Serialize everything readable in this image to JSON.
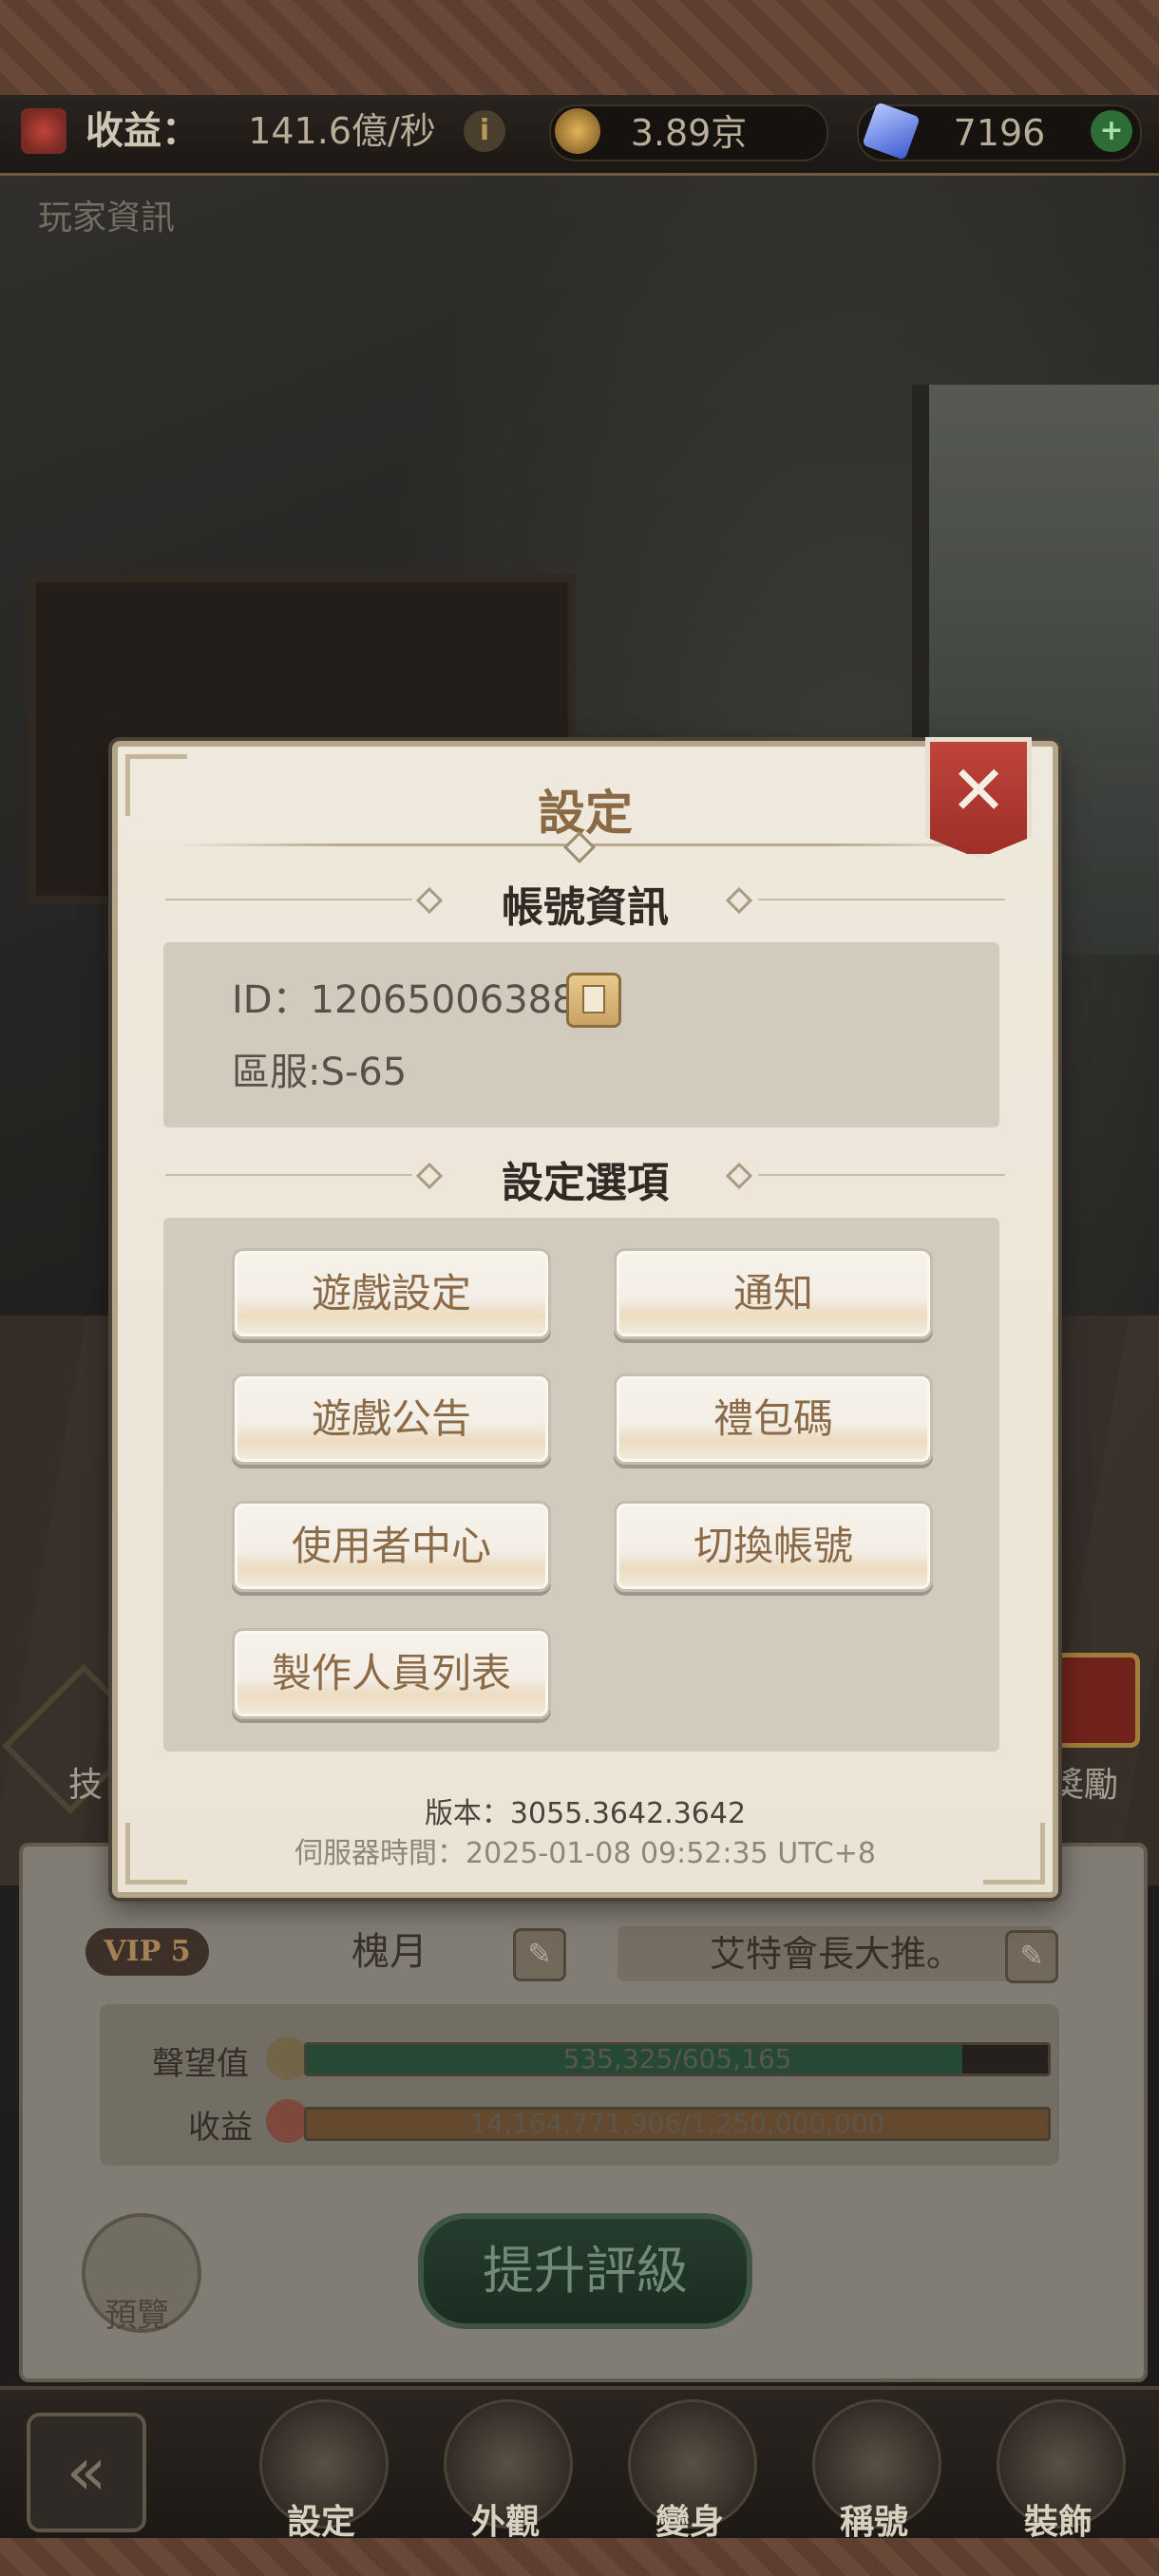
{
  "resources": {
    "income_label": "收益：",
    "income_value": "141.6億/秒",
    "coin_value": "3.89京",
    "gem_value": "7196"
  },
  "scene": {
    "player_info_label": "玩家資訊",
    "left_side_label": "技",
    "right_side_label": "獎勵"
  },
  "profile": {
    "vip": "VIP 5",
    "name": "槐月",
    "motto": "艾特會長大推。",
    "reputation_label": "聲望值",
    "reputation_text": "535,325/605,165",
    "reputation_progress": 0.884,
    "income_label": "收益",
    "income_text": "14,164,771,906/1,250,000,000",
    "income_progress": 1.0,
    "upgrade_label": "提升評級",
    "preview_label": "預覽"
  },
  "nav": {
    "items": [
      {
        "label": "設定",
        "icon": "gear-icon"
      },
      {
        "label": "外觀",
        "icon": "outfit-icon"
      },
      {
        "label": "變身",
        "icon": "mask-icon"
      },
      {
        "label": "稱號",
        "icon": "crown-icon"
      },
      {
        "label": "裝飾",
        "icon": "mushroom-icon"
      }
    ]
  },
  "modal": {
    "title": "設定",
    "account_header": "帳號資訊",
    "id_text": "ID：12065006388",
    "server_text": "區服:S-65",
    "options_header": "設定選項",
    "options": [
      "遊戲設定",
      "通知",
      "遊戲公告",
      "禮包碼",
      "使用者中心",
      "切換帳號",
      "製作人員列表"
    ],
    "version": "版本：3055.3642.3642",
    "server_time": "伺服器時間：2025-01-08 09:52:35 UTC+8"
  },
  "colors": {
    "accent_close": "#b23a31",
    "modal_bg": "#efe8dc",
    "button_text": "#8b6a47",
    "reputation_bar": "#2f5a42",
    "income_bar": "#7a5a3a"
  }
}
